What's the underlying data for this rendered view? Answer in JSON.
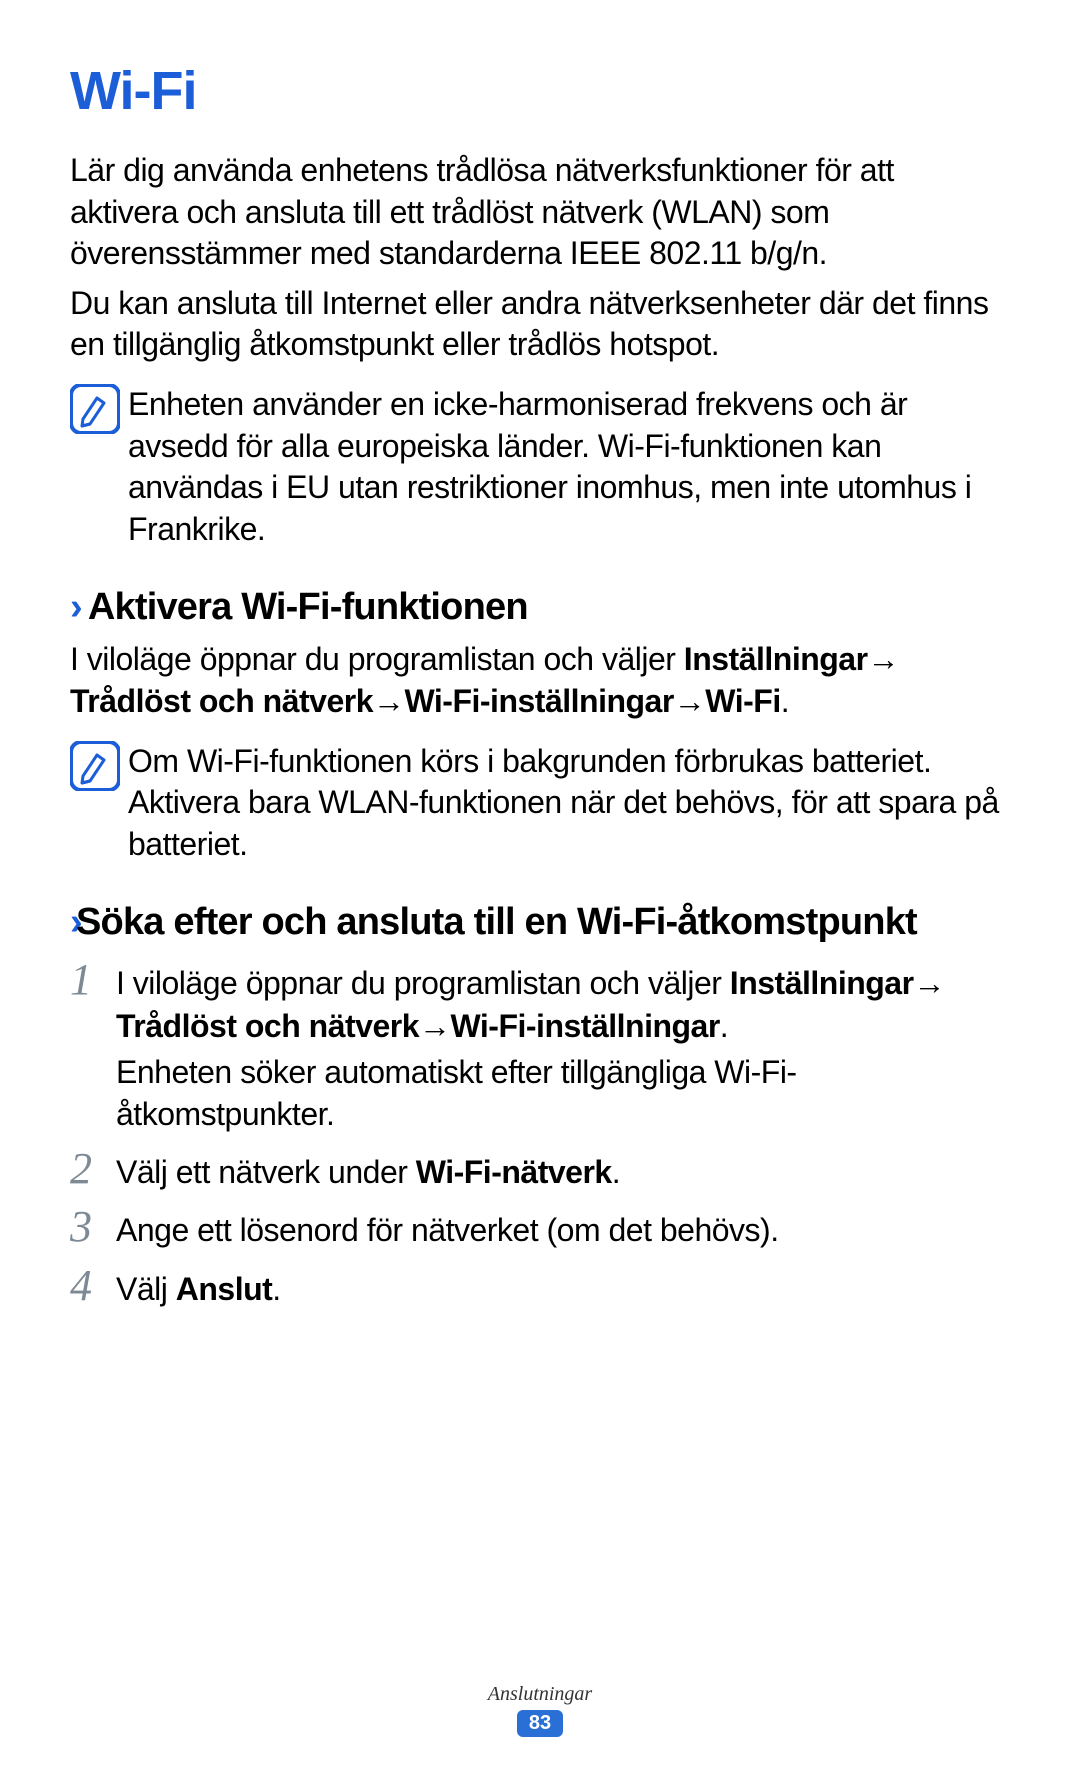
{
  "title": "Wi-Fi",
  "intro_p1": "Lär dig använda enhetens trådlösa nätverksfunktioner för att aktivera och ansluta till ett trådlöst nätverk (WLAN) som överensstämmer med standarderna IEEE 802.11 b/g/n.",
  "intro_p2": "Du kan ansluta till Internet eller andra nätverksenheter där det finns en tillgänglig åtkomstpunkt eller trådlös hotspot.",
  "note1": "Enheten använder en icke-harmoniserad frekvens och är avsedd för alla europeiska länder. Wi-Fi-funktionen kan användas i EU utan restriktioner inomhus, men inte utomhus i Frankrike.",
  "sub1": {
    "chevron": "›",
    "title": "Aktivera Wi-Fi-funktionen",
    "instr_pre": "I viloläge öppnar du programlistan och väljer ",
    "path_a": "Inställningar",
    "path_b": "Trådlöst och nätverk",
    "path_c": "Wi-Fi-inställningar",
    "path_d": "Wi-Fi",
    "arrow": " → "
  },
  "note2": "Om Wi-Fi-funktionen körs i bakgrunden förbrukas batteriet. Aktivera bara WLAN-funktionen när det behövs, för att spara på batteriet.",
  "sub2": {
    "chevron": "›",
    "title": "Söka efter och ansluta till en Wi-Fi-åtkomstpunkt"
  },
  "steps": {
    "s1": {
      "num": "1",
      "pre": "I viloläge öppnar du programlistan och väljer ",
      "path_a": "Inställningar",
      "path_b": "Trådlöst och nätverk",
      "path_c": "Wi-Fi-inställningar",
      "arrow": " → ",
      "period": ".",
      "sub": "Enheten söker automatiskt efter tillgängliga Wi-Fi-åtkomstpunkter."
    },
    "s2": {
      "num": "2",
      "pre": "Välj ett nätverk under ",
      "bold": "Wi-Fi-nätverk",
      "post": "."
    },
    "s3": {
      "num": "3",
      "text": "Ange ett lösenord för nätverket (om det behövs)."
    },
    "s4": {
      "num": "4",
      "pre": "Välj ",
      "bold": "Anslut",
      "post": "."
    }
  },
  "footer": {
    "section": "Anslutningar",
    "page": "83"
  },
  "icon_name": "note-icon"
}
